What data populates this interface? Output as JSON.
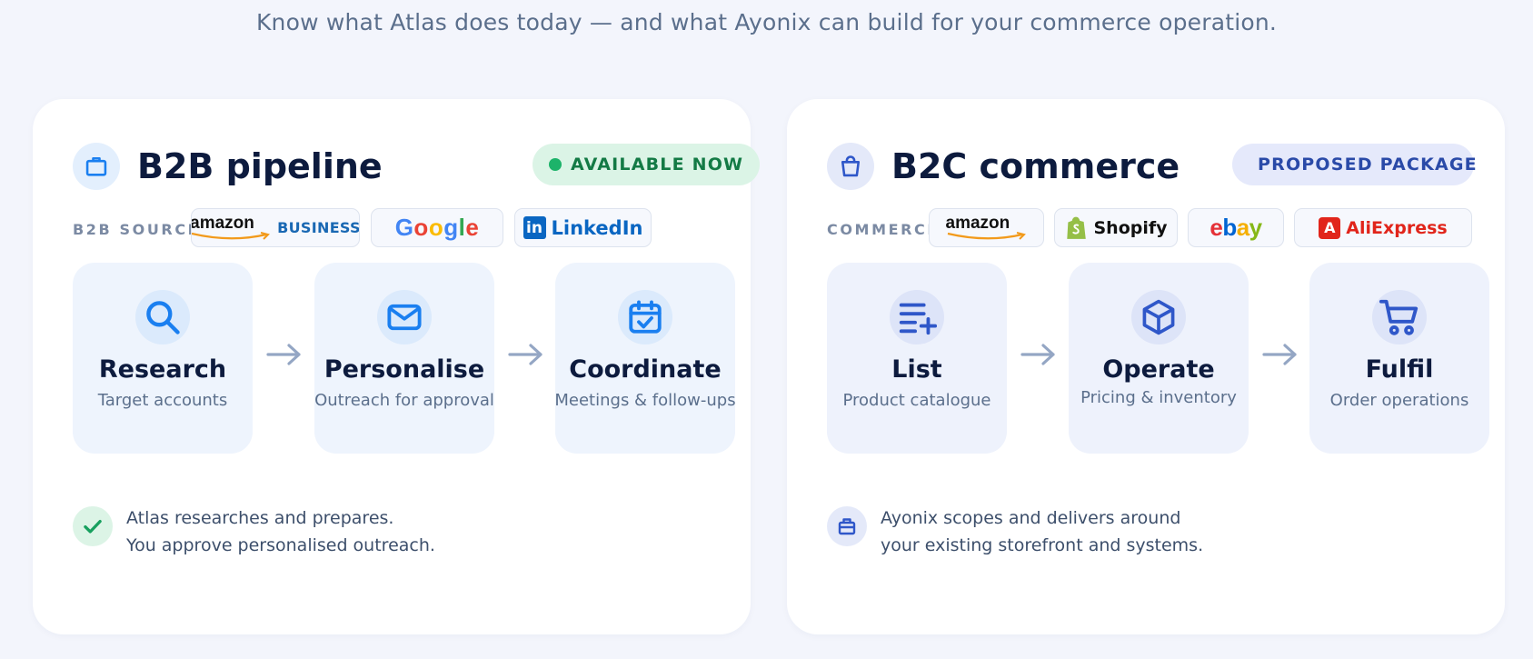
{
  "header": {
    "subtitle": "Know what Atlas does today — and what Ayonix can build for your commerce operation."
  },
  "b2b": {
    "title": "B2B pipeline",
    "badge": "AVAILABLE NOW",
    "badge_color": "#1db36a",
    "sources_label": "B2B SOURCES",
    "sources": {
      "amazon": "amazon",
      "amazon_business": "BUSINESS",
      "google": [
        "G",
        "o",
        "o",
        "g",
        "l",
        "e"
      ],
      "linkedin_mark": "in",
      "linkedin": "LinkedIn"
    },
    "steps": [
      {
        "title": "Research",
        "subtitle": "Target accounts",
        "icon": "search-icon"
      },
      {
        "title": "Personalise",
        "subtitle": "Outreach for approval",
        "icon": "mail-icon"
      },
      {
        "title": "Coordinate",
        "subtitle": "Meetings & follow-ups",
        "icon": "calendar-check-icon"
      }
    ],
    "footer": [
      "Atlas researches and prepares.",
      "You approve personalised outreach."
    ]
  },
  "b2c": {
    "title": "B2C commerce",
    "badge": "PROPOSED PACKAGE",
    "badge_color": "#2f57c9",
    "sources_label": "COMMERCE",
    "sources": {
      "amazon": "amazon",
      "shopify": "Shopify",
      "ebay": [
        "e",
        "b",
        "a",
        "y"
      ],
      "aliexpress_mark": "A",
      "aliexpress": "AliExpress"
    },
    "steps": [
      {
        "title": "List",
        "subtitle": "Product catalogue",
        "icon": "list-add-icon"
      },
      {
        "title": "Operate",
        "subtitle": "Pricing & inventory",
        "icon": "box-icon"
      },
      {
        "title": "Fulfil",
        "subtitle": "Order operations",
        "icon": "cart-icon"
      }
    ],
    "footer": [
      "Ayonix scopes and delivers around",
      "your existing storefront and systems."
    ]
  }
}
